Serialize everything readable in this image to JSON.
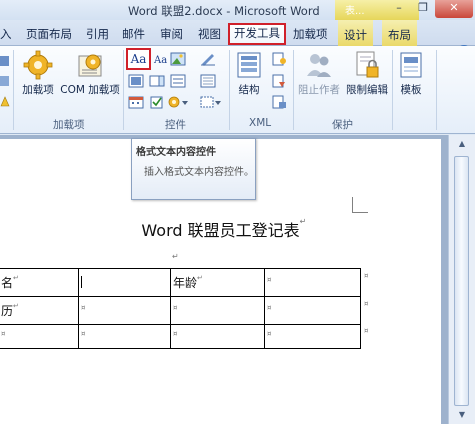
{
  "window": {
    "title": "Word 联盟2.docx - Microsoft Word",
    "context_label": "表...",
    "controls": {
      "minimize": "–",
      "restore": "❐",
      "close": "✕"
    }
  },
  "tabs": [
    {
      "label": "入"
    },
    {
      "label": "页面布局"
    },
    {
      "label": "引用"
    },
    {
      "label": "邮件"
    },
    {
      "label": "审阅"
    },
    {
      "label": "视图"
    },
    {
      "label": "开发工具",
      "selected": true
    },
    {
      "label": "加载项"
    },
    {
      "label": "设计"
    },
    {
      "label": "布局"
    }
  ],
  "help": "?",
  "ribbon": {
    "groups": {
      "addins": "加载项",
      "controls": "控件",
      "xml": "XML",
      "protect": "保护"
    },
    "buttons": {
      "addins": "加载项",
      "com_addins": "COM 加载项",
      "aa": "Aa",
      "structure": "结构",
      "block_authors": "阻止作者",
      "restrict_editing": "限制编辑",
      "template": "模板"
    }
  },
  "tooltip": {
    "title": "格式文本内容控件",
    "body": "插入格式文本内容控件。"
  },
  "document": {
    "title": "Word 联盟员工登记表",
    "para_mark": "↵",
    "cell_mark": "¤",
    "table": {
      "rows": [
        [
          "名",
          "",
          "年龄",
          ""
        ],
        [
          "历",
          "",
          "",
          ""
        ],
        [
          "",
          "",
          "",
          ""
        ]
      ]
    }
  },
  "colors": {
    "highlight_border": "#d0202a",
    "ribbon_bg": "#e5eef9",
    "doc_bg": "#9eb2cd"
  }
}
